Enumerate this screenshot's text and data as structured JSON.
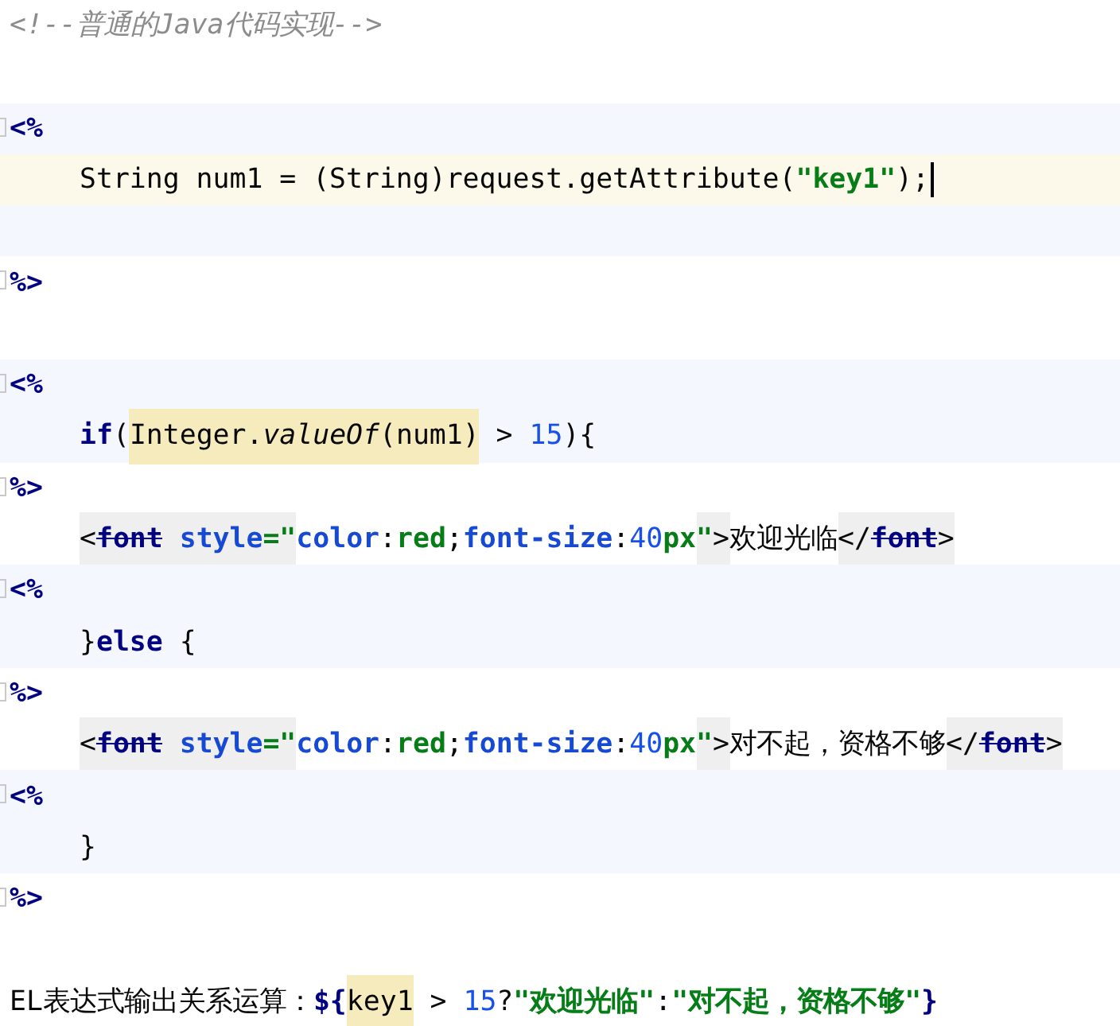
{
  "editor": {
    "lines": [
      {
        "kind": "text",
        "tokens": [
          {
            "kind": "comment",
            "text": "<!--普通的Java代码实现-->"
          }
        ]
      },
      {
        "kind": "blank"
      },
      {
        "kind": "delim",
        "scriptlet": true,
        "tokens": [
          {
            "kind": "delim",
            "text": "<%"
          }
        ]
      },
      {
        "kind": "code",
        "current": true,
        "caret": true,
        "tokens": [
          {
            "kind": "plain",
            "text": "String num1 = (String)request.getAttribute("
          },
          {
            "kind": "string",
            "text": "\"key1\""
          },
          {
            "kind": "plain",
            "text": ");"
          }
        ]
      },
      {
        "kind": "blank",
        "scriptlet": true
      },
      {
        "kind": "delim",
        "tokens": [
          {
            "kind": "delim",
            "text": "%>"
          }
        ]
      },
      {
        "kind": "blank"
      },
      {
        "kind": "delim",
        "scriptlet": true,
        "tokens": [
          {
            "kind": "delim",
            "text": "<%"
          }
        ]
      },
      {
        "kind": "code",
        "scriptlet": true,
        "tokens": [
          {
            "kind": "keyword",
            "text": "if"
          },
          {
            "kind": "plain",
            "text": "("
          },
          {
            "kind": "plain",
            "text": "Integer.",
            "highlight": true
          },
          {
            "kind": "italic",
            "text": "valueOf",
            "highlight": true
          },
          {
            "kind": "plain",
            "text": "(num1)",
            "highlight": true
          },
          {
            "kind": "plain",
            "text": " > "
          },
          {
            "kind": "number",
            "text": "15"
          },
          {
            "kind": "plain",
            "text": "){"
          }
        ]
      },
      {
        "kind": "delim",
        "tokens": [
          {
            "kind": "delim",
            "text": "%>"
          }
        ]
      },
      {
        "kind": "code",
        "tokens": [
          {
            "kind": "plain",
            "text": "<",
            "shaded": true
          },
          {
            "kind": "strike",
            "text": "font",
            "shaded": true
          },
          {
            "kind": "attr",
            "text": " style",
            "shaded": true
          },
          {
            "kind": "string",
            "text": "=\"",
            "shaded": true
          },
          {
            "kind": "attr",
            "text": "color"
          },
          {
            "kind": "plain",
            "text": ":"
          },
          {
            "kind": "string",
            "text": "red"
          },
          {
            "kind": "plain",
            "text": ";"
          },
          {
            "kind": "attr",
            "text": "font-size"
          },
          {
            "kind": "plain",
            "text": ":"
          },
          {
            "kind": "number",
            "text": "40"
          },
          {
            "kind": "string",
            "text": "px"
          },
          {
            "kind": "string",
            "text": "\"",
            "shaded": true
          },
          {
            "kind": "plain",
            "text": ">",
            "shaded": true
          },
          {
            "kind": "plain",
            "text": "欢迎光临"
          },
          {
            "kind": "plain",
            "text": "</",
            "shaded": true
          },
          {
            "kind": "strike",
            "text": "font",
            "shaded": true
          },
          {
            "kind": "plain",
            "text": ">",
            "shaded": true
          }
        ]
      },
      {
        "kind": "delim",
        "scriptlet": true,
        "tokens": [
          {
            "kind": "delim",
            "text": "<%"
          }
        ]
      },
      {
        "kind": "code",
        "scriptlet": true,
        "tokens": [
          {
            "kind": "plain",
            "text": "}"
          },
          {
            "kind": "keyword",
            "text": "else"
          },
          {
            "kind": "plain",
            "text": " {"
          }
        ]
      },
      {
        "kind": "delim",
        "tokens": [
          {
            "kind": "delim",
            "text": "%>"
          }
        ]
      },
      {
        "kind": "code",
        "tokens": [
          {
            "kind": "plain",
            "text": "<",
            "shaded": true
          },
          {
            "kind": "strike",
            "text": "font",
            "shaded": true
          },
          {
            "kind": "attr",
            "text": " style",
            "shaded": true
          },
          {
            "kind": "string",
            "text": "=\"",
            "shaded": true
          },
          {
            "kind": "attr",
            "text": "color"
          },
          {
            "kind": "plain",
            "text": ":"
          },
          {
            "kind": "string",
            "text": "red"
          },
          {
            "kind": "plain",
            "text": ";"
          },
          {
            "kind": "attr",
            "text": "font-size"
          },
          {
            "kind": "plain",
            "text": ":"
          },
          {
            "kind": "number",
            "text": "40"
          },
          {
            "kind": "string",
            "text": "px"
          },
          {
            "kind": "string",
            "text": "\"",
            "shaded": true
          },
          {
            "kind": "plain",
            "text": ">",
            "shaded": true
          },
          {
            "kind": "plain",
            "text": "对不起，资格不够"
          },
          {
            "kind": "plain",
            "text": "</",
            "shaded": true
          },
          {
            "kind": "strike",
            "text": "font",
            "shaded": true
          },
          {
            "kind": "plain",
            "text": ">",
            "shaded": true
          }
        ]
      },
      {
        "kind": "delim",
        "scriptlet": true,
        "tokens": [
          {
            "kind": "delim",
            "text": "<%"
          }
        ]
      },
      {
        "kind": "code",
        "scriptlet": true,
        "tokens": [
          {
            "kind": "plain",
            "text": "}"
          }
        ]
      },
      {
        "kind": "delim",
        "tokens": [
          {
            "kind": "delim",
            "text": "%>"
          }
        ]
      },
      {
        "kind": "blank"
      },
      {
        "kind": "text",
        "tokens": [
          {
            "kind": "plain",
            "text": "EL表达式输出关系运算："
          },
          {
            "kind": "delim",
            "text": "${"
          },
          {
            "kind": "plain",
            "text": "key1",
            "highlight": true
          },
          {
            "kind": "plain",
            "text": " > "
          },
          {
            "kind": "number",
            "text": "15"
          },
          {
            "kind": "plain",
            "text": "?"
          },
          {
            "kind": "string",
            "text": "\"欢迎光临\""
          },
          {
            "kind": "plain",
            "text": ":"
          },
          {
            "kind": "string",
            "text": "\"对不起，资格不够\""
          },
          {
            "kind": "delim",
            "text": "}"
          }
        ]
      }
    ]
  }
}
